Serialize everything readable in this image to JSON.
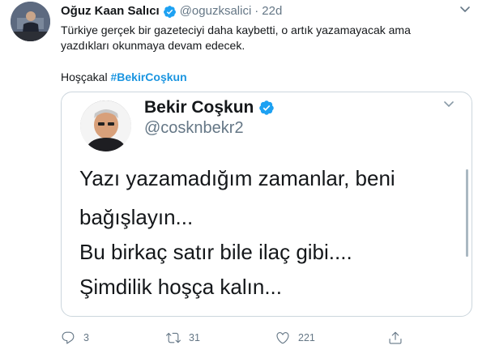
{
  "tweet": {
    "author_name": "Oğuz Kaan Salıcı",
    "handle": "@oguzksalici",
    "separator": "·",
    "time": "22d",
    "text_lines": [
      "Türkiye gerçek bir gazeteciyi daha kaybetti, o artık yazamayacak ama",
      "yazdıkları okunmaya devam edecek."
    ],
    "closing_text": "Hoşçakal",
    "hashtag": "#BekirCoşkun"
  },
  "embedded_tweet": {
    "author_name": "Bekir Coşkun",
    "handle": "@cosknbekr2",
    "lines": [
      "Yazı yazamadığım zamanlar, beni",
      "bağışlayın...",
      "Bu birkaç satır bile ilaç gibi....",
      "Şimdilik hoşça kalın..."
    ]
  },
  "actions": {
    "reply_count": "3",
    "retweet_count": "31",
    "like_count": "221"
  },
  "icons": {
    "verified": "verified-badge-icon",
    "caret": "chevron-down-icon",
    "reply": "reply-icon",
    "retweet": "retweet-icon",
    "like": "heart-icon",
    "share": "share-icon"
  },
  "colors": {
    "accent": "#1da1f2",
    "hashtag": "#1b95e0",
    "muted": "#657786",
    "border": "#ccd6dd"
  }
}
